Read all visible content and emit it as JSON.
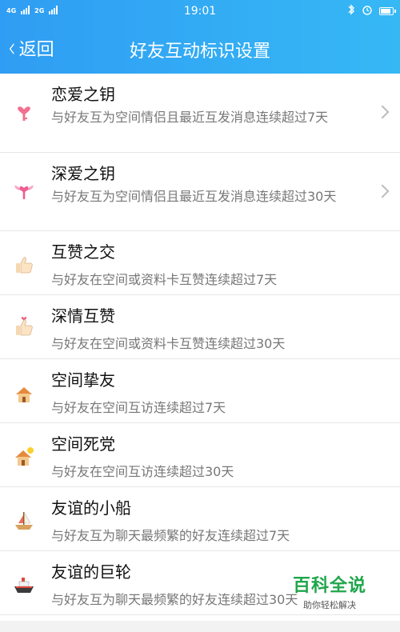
{
  "status_bar": {
    "network_left": "4G",
    "network_right": "2G",
    "time": "19:01"
  },
  "header": {
    "back_label": "返回",
    "title": "好友互动标识设置"
  },
  "items": [
    {
      "icon": "key-heart-icon",
      "name": "恋爱之钥",
      "desc": "与好友互为空间情侣且最近互发消息连续超过7天"
    },
    {
      "icon": "winged-key-icon",
      "name": "深爱之钥",
      "desc": "与好友互为空间情侣且最近互发消息连续超过30天"
    },
    {
      "icon": "thumbs-up-icon",
      "name": "互赞之交",
      "desc": "与好友在空间或资料卡互赞连续超过7天"
    },
    {
      "icon": "thumbs-up-heart-icon",
      "name": "深情互赞",
      "desc": "与好友在空间或资料卡互赞连续超过30天"
    },
    {
      "icon": "house-icon",
      "name": "空间挚友",
      "desc": "与好友在空间互访连续超过7天"
    },
    {
      "icon": "house-sun-icon",
      "name": "空间死党",
      "desc": "与好友在空间互访连续超过30天"
    },
    {
      "icon": "sailboat-icon",
      "name": "友谊的小船",
      "desc": "与好友互为聊天最频繁的好友连续超过7天"
    },
    {
      "icon": "ship-icon",
      "name": "友谊的巨轮",
      "desc": "与好友互为聊天最频繁的好友连续超过30天"
    }
  ],
  "watermark": {
    "title": "百科全说",
    "subtitle": "助你轻松解决"
  }
}
